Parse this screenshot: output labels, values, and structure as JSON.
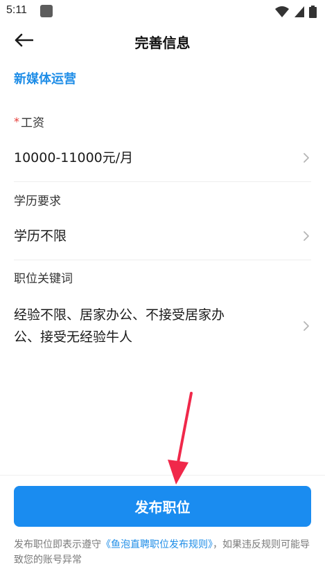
{
  "status_bar": {
    "time": "5:11",
    "icons": [
      "app-icon",
      "wifi-icon",
      "signal-icon",
      "battery-icon"
    ]
  },
  "header": {
    "back_icon": "arrow-left-icon",
    "title": "完善信息"
  },
  "job": {
    "title": "新媒体运营"
  },
  "fields": {
    "salary": {
      "required_mark": "*",
      "label": "工资",
      "value": "10000-11000元/月"
    },
    "education": {
      "label": "学历要求",
      "value": "学历不限"
    },
    "keywords": {
      "label": "职位关键词",
      "value_line1": "经验不限、居家办公、不接受居家办",
      "value_line2": "公、接受无经验牛人"
    }
  },
  "actions": {
    "publish_label": "发布职位"
  },
  "footer": {
    "note_prefix": "发布职位即表示遵守",
    "rules_link": "《鱼泡直聘职位发布规则》",
    "note_suffix": "，如果违反规则可能导致您的账号异常"
  },
  "colors": {
    "accent": "#1a8cf0",
    "link": "#1e8de7",
    "required": "#e53935",
    "annotation_arrow": "#f0284a"
  }
}
